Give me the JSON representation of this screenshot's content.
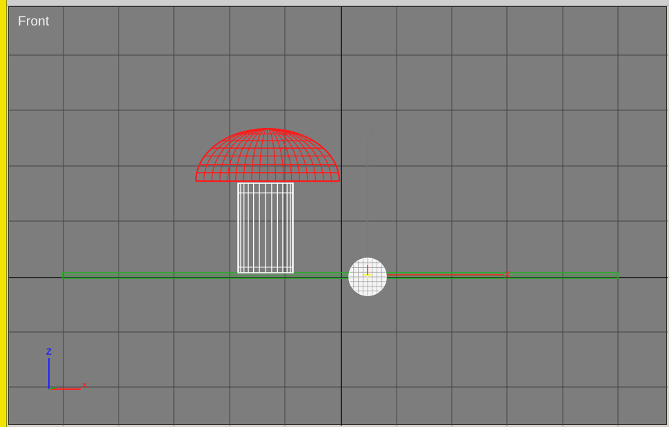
{
  "viewport": {
    "label": "Front",
    "active_border_color": "#f3e400",
    "background_color": "#7d7d7d",
    "grid_color": "#444444",
    "home_axis_color": "#111111"
  },
  "objects": {
    "dome": {
      "name": "mushroom-cap",
      "wire_color": "#ff1a1a"
    },
    "stem": {
      "name": "mushroom-stem",
      "wire_color": "#ffffff"
    },
    "ground": {
      "name": "ground-plane",
      "wire_color": "#22b022"
    },
    "sphere": {
      "name": "selected-sphere",
      "wire_color": "#ffffff"
    }
  },
  "gizmo": {
    "z_label": "Z",
    "x_label": "X",
    "z_color": "#7a7a7a",
    "x_color": "#ff2020",
    "center_color": "#ffff00"
  },
  "axis_tripod": {
    "z_label": "Z",
    "x_label": "x",
    "z_color": "#2222ff",
    "x_color": "#ff2020",
    "y_color": "#20b020"
  }
}
